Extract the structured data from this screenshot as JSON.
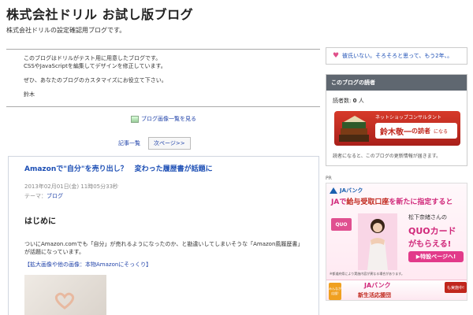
{
  "header": {
    "title": "株式会社ドリル お試し版ブログ",
    "description": "株式会社ドリルの設定確認用ブログです。"
  },
  "intro": {
    "line1": "このブログはドリルがテスト用に用意したブログです。",
    "line2": "CSSやJavaScriptを編集してデザインを修正しています。",
    "line3": "ぜひ、あなたのブログのカスタマイズにお役立て下さい。",
    "signature": "鈴木"
  },
  "image_list_link": "ブログ画像一覧を見る",
  "pager": {
    "list_label": "記事一覧",
    "next_label": "次ページ>>"
  },
  "article": {
    "title": "Amazonで\"自分\"を売り出し？　変わった履歴書が話題に",
    "date": "2013年02月01日(金) 11時05分33秒",
    "theme_prefix": "テーマ：",
    "theme": "ブログ",
    "section_heading": "はじめに",
    "body_line1": "ついにAmazon.comでも「自分」が売れるようになったのか、と勘違いしてしまいそうな「Amazon風履歴書」",
    "body_line2": "が話題になっています。",
    "related_link": "【拡大画像や他の画像：本物Amazonにそっくり】"
  },
  "sidebar": {
    "message": "彼氏いない。そろそろと思って、もう2年、。",
    "readers_heading": "このブログの読者",
    "readers_count_label": "読者数:",
    "readers_count": "0",
    "readers_unit": "人",
    "banner_sub": "ネットショップコンサルタント",
    "banner_name": "鈴木敬一",
    "banner_suffix": "の読者",
    "banner_suffix2": "になる",
    "readers_note": "読者になると、このブログの更新情報が届きます。"
  },
  "ad": {
    "pr_label": "PR",
    "brand": "JAバンク",
    "headline_prefix": "JAで",
    "headline_strong": "給与受取口座",
    "headline_suffix": "を新たに指定すると",
    "quo_badge": "QUO",
    "person_name": "松下奈緒さんの",
    "card_name": "QUOカード",
    "get_text": "がもらえる!",
    "cta": "▶特設ページへ!",
    "small_text": "※都道府県により実施内容が異なる場合があります。",
    "bottom_left": "みんなが応援!",
    "bottom_brand": "JAバンク",
    "bottom_main": "新生活応援団",
    "bottom_badge": "も実施中!"
  },
  "colors": {
    "link": "#2244aa",
    "title_blue": "#1d4fb5",
    "sidebar_head": "#5f6770",
    "banner_red": "#c0261c",
    "ad_pink": "#d0287a"
  }
}
